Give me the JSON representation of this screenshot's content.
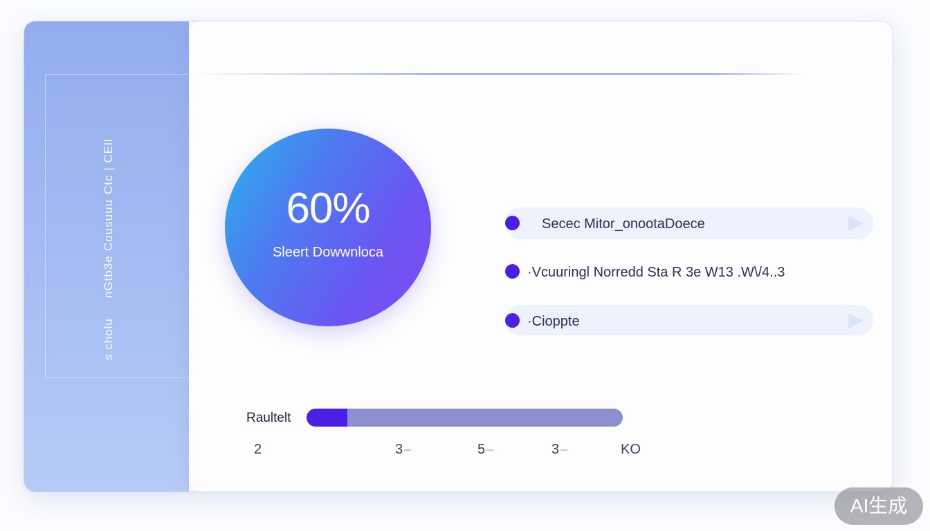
{
  "sidebar": {
    "labels": [
      "Ctc | CEll",
      "Cousuuu",
      "nGtb3e",
      "s cholu"
    ]
  },
  "main": {
    "circle": {
      "value": "60%",
      "label": "Sleert Dowwnloca"
    },
    "status_items": [
      {
        "text": "Secec Mitor_onootaDoece",
        "highlighted": true
      },
      {
        "text": "·Vcuuringl Norredd Sta R 3e W13 .W\\/4..3",
        "highlighted": false
      },
      {
        "text": "·Cioppte",
        "highlighted": true
      }
    ],
    "progress": {
      "label": "Raultelt",
      "fraction": 0.13,
      "ticks": [
        "2",
        "3",
        "5",
        "3",
        "KO"
      ]
    }
  },
  "badge": "AI生成",
  "colors": {
    "accent": "#4a1fe6",
    "sidebar": "#9fb7f0",
    "track": "#8c90d0"
  }
}
